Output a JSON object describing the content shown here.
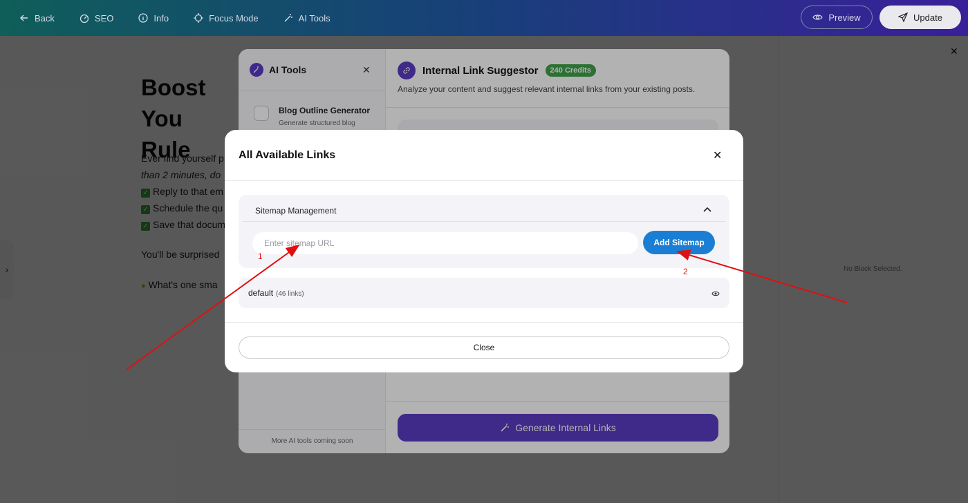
{
  "topbar": {
    "nav": [
      {
        "label": "Back",
        "icon": "arrow-left-icon"
      },
      {
        "label": "SEO",
        "icon": "gauge-icon"
      },
      {
        "label": "Info",
        "icon": "info-icon"
      },
      {
        "label": "Focus Mode",
        "icon": "focus-icon"
      },
      {
        "label": "AI Tools",
        "icon": "magic-wand-icon"
      }
    ],
    "preview_label": "Preview",
    "update_label": "Update"
  },
  "editor": {
    "title": "Boost You… Rule",
    "title_line1": "Boost You",
    "title_line2": "Rule",
    "p1": "Ever find yourself p",
    "p2": "than 2 minutes, do",
    "check1": "Reply to that em",
    "check2": "Schedule the qu",
    "check3": "Save that docum",
    "p3": "You'll be surprised",
    "p4": "What's one sma"
  },
  "right_panel": {
    "empty_text": "No Block Selected."
  },
  "ai_tools": {
    "title": "AI Tools",
    "tool": {
      "title": "Blog Outline Generator",
      "subtitle": "Generate structured blog"
    },
    "footer": "More AI tools coming soon",
    "main_title": "Internal Link Suggestor",
    "credits": "240 Credits",
    "description": "Analyze your content and suggest relevant internal links from your existing posts.",
    "generate_label": "Generate Internal Links"
  },
  "links_modal": {
    "title": "All Available Links",
    "sitemap_label": "Sitemap Management",
    "input_placeholder": "Enter sitemap URL",
    "add_label": "Add Sitemap",
    "link_name": "default",
    "link_count": "(46 links)",
    "close_label": "Close"
  },
  "annotations": {
    "one": "1",
    "two": "2",
    "color": "#e01010"
  }
}
